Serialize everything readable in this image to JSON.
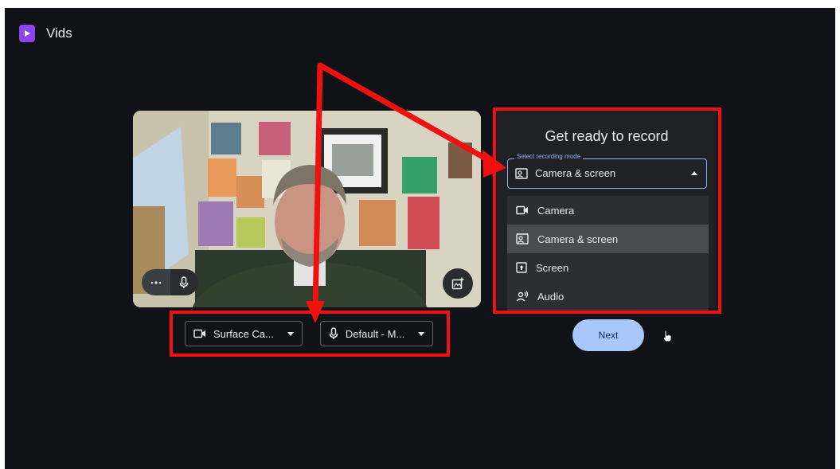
{
  "app": {
    "title": "Vids"
  },
  "panel": {
    "title": "Get ready to record",
    "mode_label": "Select recording mode",
    "mode_value": "Camera & screen",
    "options": [
      {
        "label": "Camera",
        "icon": "videocam-icon"
      },
      {
        "label": "Camera & screen",
        "icon": "camera-screen-icon",
        "selected": true
      },
      {
        "label": "Screen",
        "icon": "screen-share-icon"
      },
      {
        "label": "Audio",
        "icon": "audio-icon"
      }
    ]
  },
  "devices": {
    "camera": "Surface Ca...",
    "microphone": "Default - M..."
  },
  "next_label": "Next",
  "colors": {
    "background": "#111217",
    "accent": "#a8c7fa",
    "annotation": "#ef1010",
    "brand": "#8e44ec"
  }
}
